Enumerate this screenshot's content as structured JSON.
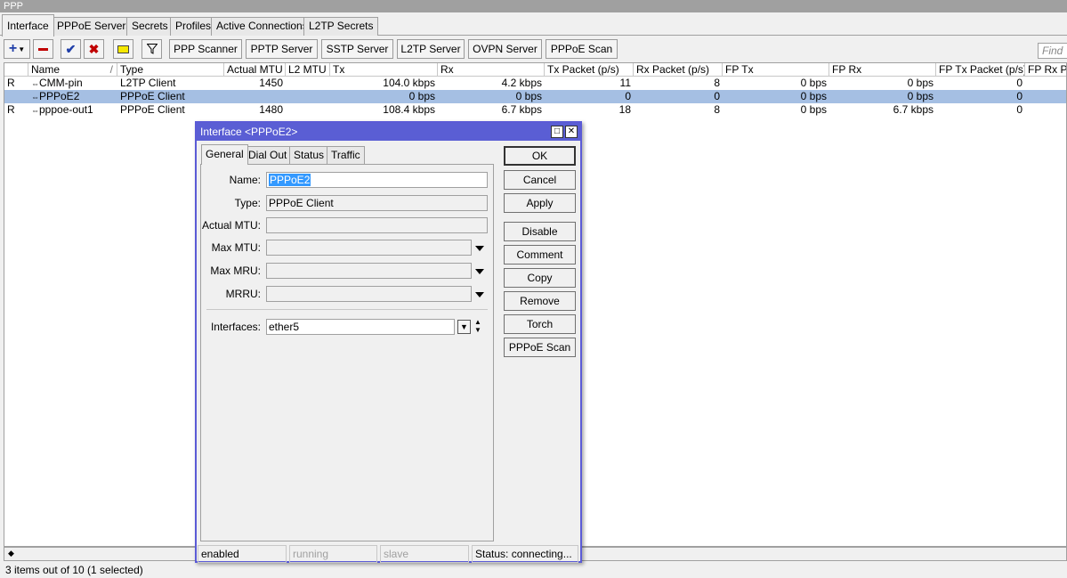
{
  "window": {
    "title": "PPP"
  },
  "tabs": [
    "Interface",
    "PPPoE Servers",
    "Secrets",
    "Profiles",
    "Active Connections",
    "L2TP Secrets"
  ],
  "toolbar": {
    "buttons": [
      "PPP Scanner",
      "PPTP Server",
      "SSTP Server",
      "L2TP Server",
      "OVPN Server",
      "PPPoE Scan"
    ],
    "find_placeholder": "Find"
  },
  "table": {
    "headers": [
      "Name",
      "Type",
      "Actual MTU",
      "L2 MTU",
      "Tx",
      "Rx",
      "Tx Packet (p/s)",
      "Rx Packet (p/s)",
      "FP Tx",
      "FP Rx",
      "FP Tx Packet (p/s)",
      "FP Rx Pa"
    ],
    "rows": [
      {
        "flag": "R",
        "name": "CMM-pin",
        "type": "L2TP Client",
        "mtu": "1450",
        "l2mtu": "",
        "tx": "104.0 kbps",
        "rx": "4.2 kbps",
        "txp": "11",
        "rxp": "8",
        "fptx": "0 bps",
        "fprx": "0 bps",
        "fptxp": "0"
      },
      {
        "flag": "",
        "name": "PPPoE2",
        "type": "PPPoE Client",
        "mtu": "",
        "l2mtu": "",
        "tx": "0 bps",
        "rx": "0 bps",
        "txp": "0",
        "rxp": "0",
        "fptx": "0 bps",
        "fprx": "0 bps",
        "fptxp": "0"
      },
      {
        "flag": "R",
        "name": "pppoe-out1",
        "type": "PPPoE Client",
        "mtu": "1480",
        "l2mtu": "",
        "tx": "108.4 kbps",
        "rx": "6.7 kbps",
        "txp": "18",
        "rxp": "8",
        "fptx": "0 bps",
        "fprx": "6.7 kbps",
        "fptxp": "0"
      }
    ]
  },
  "status": {
    "text": "3 items out of 10 (1 selected)"
  },
  "dialog": {
    "title": "Interface <PPPoE2>",
    "tabs": [
      "General",
      "Dial Out",
      "Status",
      "Traffic"
    ],
    "labels": {
      "name": "Name:",
      "type": "Type:",
      "actual_mtu": "Actual MTU:",
      "max_mtu": "Max MTU:",
      "max_mru": "Max MRU:",
      "mrru": "MRRU:",
      "interfaces": "Interfaces:"
    },
    "values": {
      "name": "PPPoE2",
      "type": "PPPoE Client",
      "interfaces": "ether5"
    },
    "buttons": [
      "OK",
      "Cancel",
      "Apply",
      "Disable",
      "Comment",
      "Copy",
      "Remove",
      "Torch",
      "PPPoE Scan"
    ],
    "status": [
      "enabled",
      "running",
      "slave",
      "Status: connecting..."
    ]
  }
}
